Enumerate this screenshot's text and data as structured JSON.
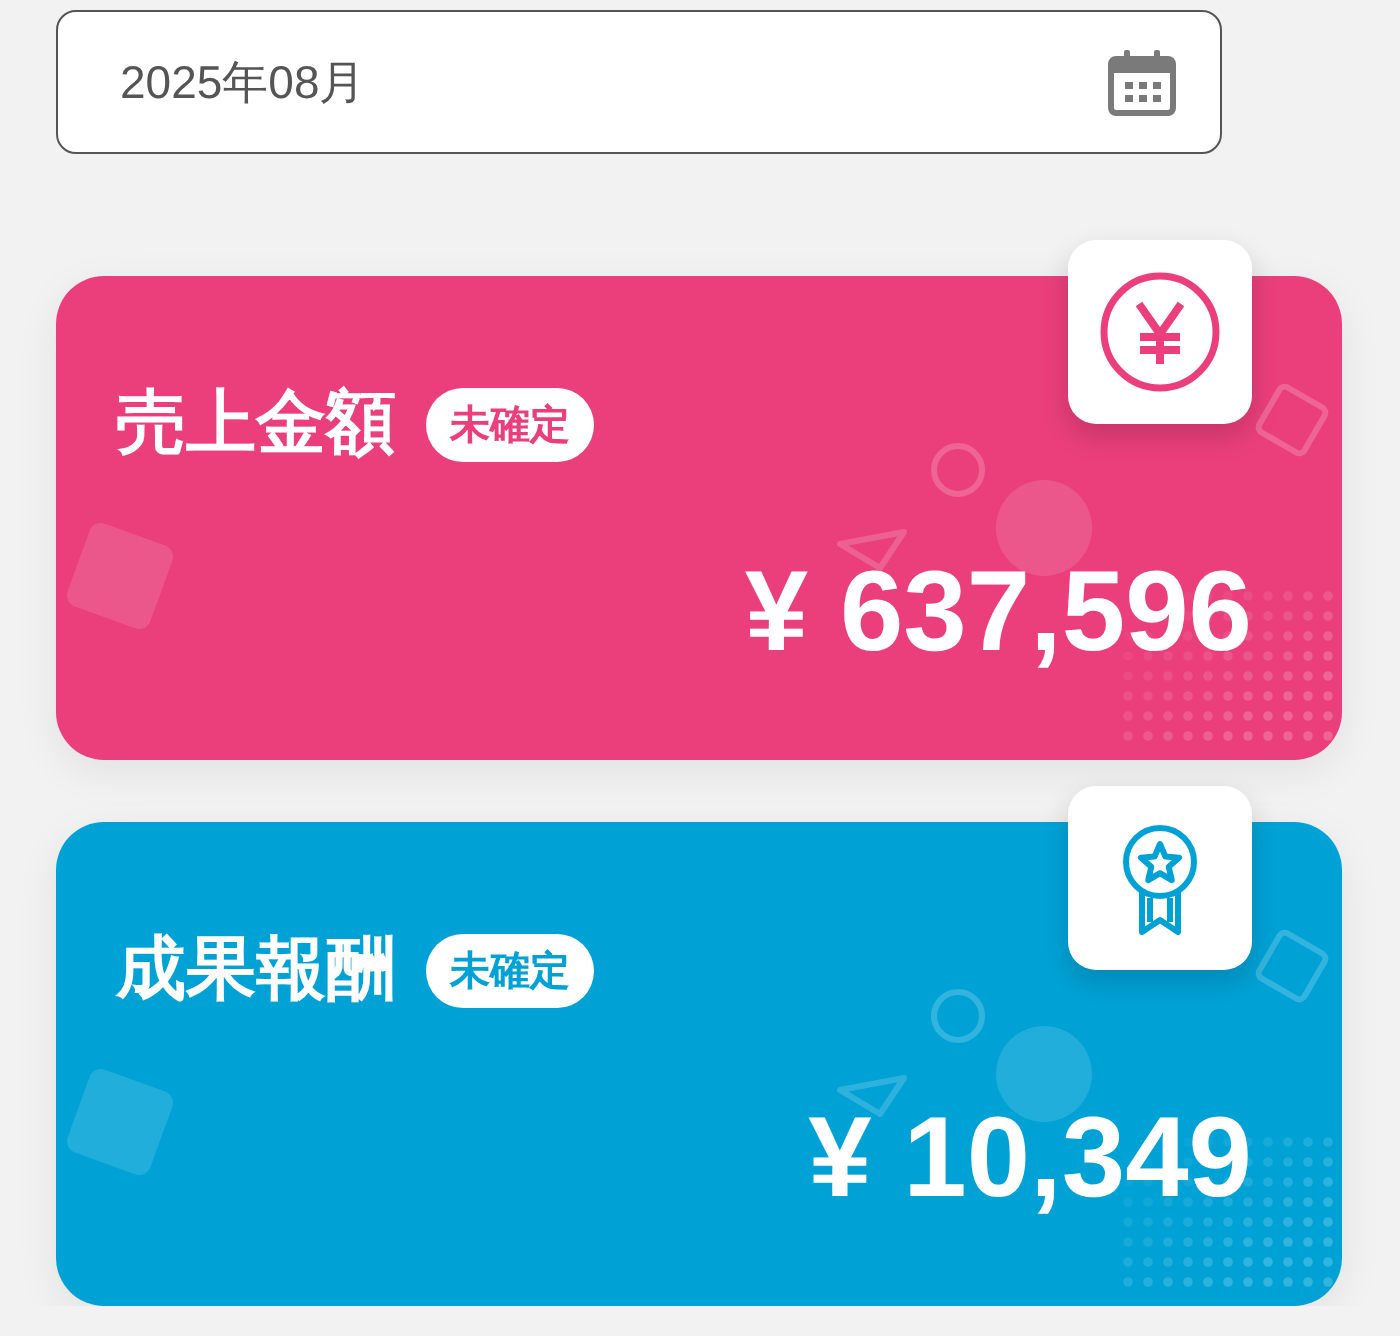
{
  "date_field": {
    "value": "2025年08月"
  },
  "cards": [
    {
      "kind": "sales",
      "title": "売上金額",
      "badge": "未確定",
      "amount": "¥ 637,596",
      "color": "#ea3f7a"
    },
    {
      "kind": "reward",
      "title": "成果報酬",
      "badge": "未確定",
      "amount": "¥ 10,349",
      "color": "#00a2d6"
    }
  ]
}
